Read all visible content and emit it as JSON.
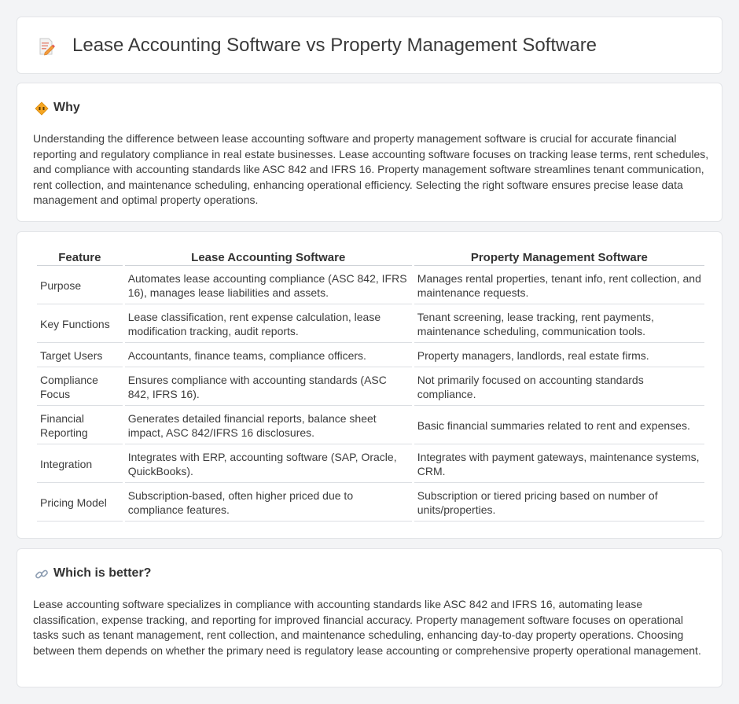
{
  "header": {
    "title": "Lease Accounting Software vs Property Management Software",
    "icon": "document-edit-icon"
  },
  "why": {
    "title": "Why",
    "icon": "diamond-sign-icon",
    "text": "Understanding the difference between lease accounting software and property management software is crucial for accurate financial reporting and regulatory compliance in real estate businesses. Lease accounting software focuses on tracking lease terms, rent schedules, and compliance with accounting standards like ASC 842 and IFRS 16. Property management software streamlines tenant communication, rent collection, and maintenance scheduling, enhancing operational efficiency. Selecting the right software ensures precise lease data management and optimal property operations."
  },
  "comparison": {
    "headers": [
      "Feature",
      "Lease Accounting Software",
      "Property Management Software"
    ],
    "rows": [
      {
        "feature": "Purpose",
        "lease": "Automates lease accounting compliance (ASC 842, IFRS 16), manages lease liabilities and assets.",
        "property": "Manages rental properties, tenant info, rent collection, and maintenance requests."
      },
      {
        "feature": "Key Functions",
        "lease": "Lease classification, rent expense calculation, lease modification tracking, audit reports.",
        "property": "Tenant screening, lease tracking, rent payments, maintenance scheduling, communication tools."
      },
      {
        "feature": "Target Users",
        "lease": "Accountants, finance teams, compliance officers.",
        "property": "Property managers, landlords, real estate firms."
      },
      {
        "feature": "Compliance Focus",
        "lease": "Ensures compliance with accounting standards (ASC 842, IFRS 16).",
        "property": "Not primarily focused on accounting standards compliance."
      },
      {
        "feature": "Financial Reporting",
        "lease": "Generates detailed financial reports, balance sheet impact, ASC 842/IFRS 16 disclosures.",
        "property": "Basic financial summaries related to rent and expenses."
      },
      {
        "feature": "Integration",
        "lease": "Integrates with ERP, accounting software (SAP, Oracle, QuickBooks).",
        "property": "Integrates with payment gateways, maintenance systems, CRM."
      },
      {
        "feature": "Pricing Model",
        "lease": "Subscription-based, often higher priced due to compliance features.",
        "property": "Subscription or tiered pricing based on number of units/properties."
      }
    ]
  },
  "better": {
    "title": "Which is better?",
    "icon": "link-icon",
    "text": "Lease accounting software specializes in compliance with accounting standards like ASC 842 and IFRS 16, automating lease classification, expense tracking, and reporting for improved financial accuracy. Property management software focuses on operational tasks such as tenant management, rent collection, and maintenance scheduling, enhancing day-to-day property operations. Choosing between them depends on whether the primary need is regulatory lease accounting or comprehensive property operational management."
  }
}
